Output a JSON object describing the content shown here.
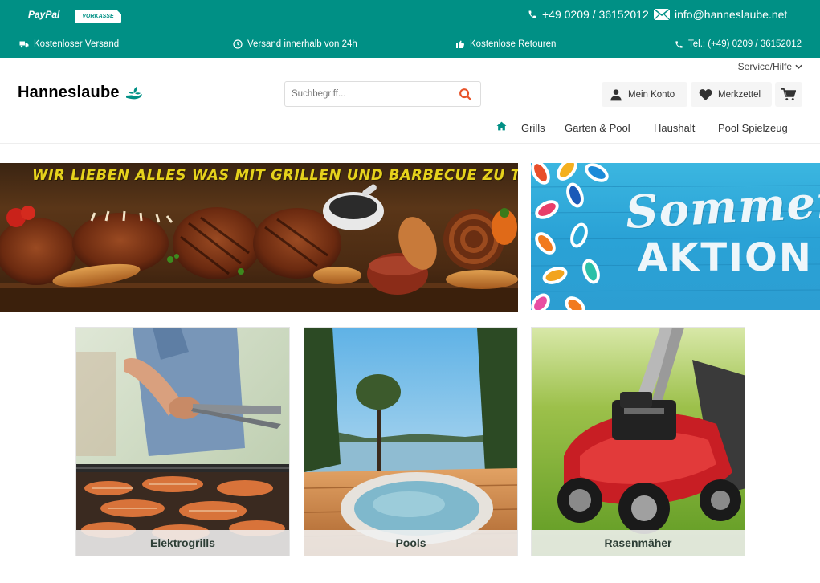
{
  "topbar": {
    "payment_paypal": "PayPal",
    "payment_vorkasse": "VORKASSE",
    "phone": "+49 0209 / 36152012",
    "email": "info@hanneslaube.net"
  },
  "usps": {
    "shipping": "Kostenloser Versand",
    "delivery": "Versand innerhalb von 24h",
    "returns": "Kostenlose Retouren",
    "tel": "Tel.: (+49) 0209 / 36152012"
  },
  "header": {
    "service": "Service/Hilfe",
    "logo": "Hanneslaube",
    "search_placeholder": "Suchbegriff...",
    "account": "Mein Konto",
    "wishlist": "Merkzettel"
  },
  "nav": {
    "items": [
      "Grills",
      "Garten & Pool",
      "Haushalt",
      "Pool Spielzeug"
    ]
  },
  "banners": {
    "grill_headline": "WIR LIEBEN ALLES WAS MIT GRILLEN UND BARBECUE ZU TUN HAT",
    "summer_line1": "Sommer",
    "summer_line2": "AKTION"
  },
  "categories": [
    {
      "label": "Elektrogrills"
    },
    {
      "label": "Pools"
    },
    {
      "label": "Rasenmäher"
    }
  ],
  "colors": {
    "brand_teal": "#009085",
    "search_icon": "#e8542a"
  }
}
